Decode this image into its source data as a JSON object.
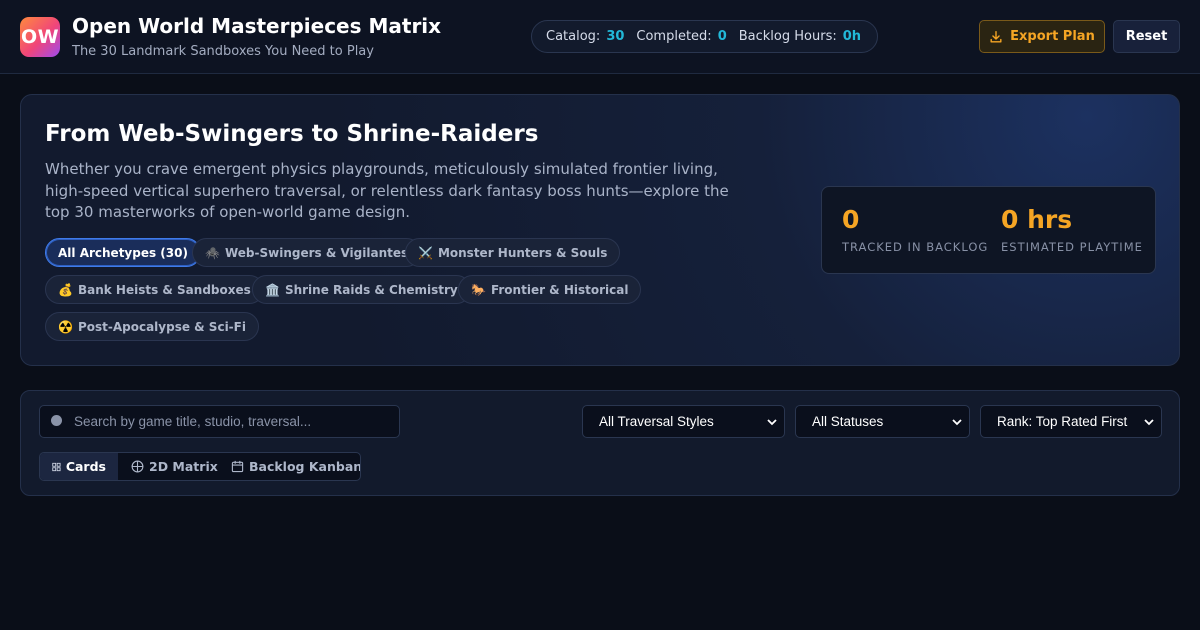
{
  "header": {
    "logo_text": "OW",
    "title": "Open World Masterpieces Matrix",
    "subtitle": "The 30 Landmark Sandboxes You Need to Play",
    "stats": {
      "catalog_label": "Catalog:",
      "catalog_value": "30",
      "completed_label": "Completed:",
      "completed_value": "0",
      "hours_label": "Backlog Hours:",
      "hours_value": "0h"
    },
    "export_label": "Export Plan",
    "reset_label": "Reset"
  },
  "hero": {
    "title": "From Web-Swingers to Shrine-Raiders",
    "description": "Whether you crave emergent physics playgrounds, meticulously simulated frontier living, high-speed vertical superhero traversal, or relentless dark fantasy boss hunts—explore the top 30 masterworks of open-world game design.",
    "chips": [
      {
        "emoji": "",
        "label": "All Archetypes (30)",
        "active": true
      },
      {
        "emoji": "🕷️",
        "label": "Web-Swingers & Vigilantes",
        "active": false
      },
      {
        "emoji": "⚔️",
        "label": "Monster Hunters & Souls",
        "active": false
      },
      {
        "emoji": "💰",
        "label": "Bank Heists & Sandboxes",
        "active": false
      },
      {
        "emoji": "🏛️",
        "label": "Shrine Raids & Chemistry",
        "active": false
      },
      {
        "emoji": "🐎",
        "label": "Frontier & Historical",
        "active": false
      },
      {
        "emoji": "☢️",
        "label": "Post-Apocalypse & Sci-Fi",
        "active": false
      }
    ],
    "tracked_value": "0",
    "tracked_label": "TRACKED IN BACKLOG",
    "playtime_value": "0 hrs",
    "playtime_label": "ESTIMATED PLAYTIME"
  },
  "filters": {
    "search_placeholder": "Search by game title, studio, traversal...",
    "traversal_selected": "All Traversal Styles",
    "status_selected": "All Statuses",
    "sort_selected": "Rank: Top Rated First",
    "views": [
      {
        "label": "Cards",
        "icon": "grid-icon",
        "active": true
      },
      {
        "label": "2D Matrix",
        "icon": "crosshair-icon",
        "active": false
      },
      {
        "label": "Backlog Kanban",
        "icon": "calendar-icon",
        "active": false
      }
    ]
  },
  "colors": {
    "accent_orange": "#f5a524",
    "accent_cyan": "#22b8d8",
    "accent_blue": "#3f7bea",
    "background": "#0a0e18"
  }
}
